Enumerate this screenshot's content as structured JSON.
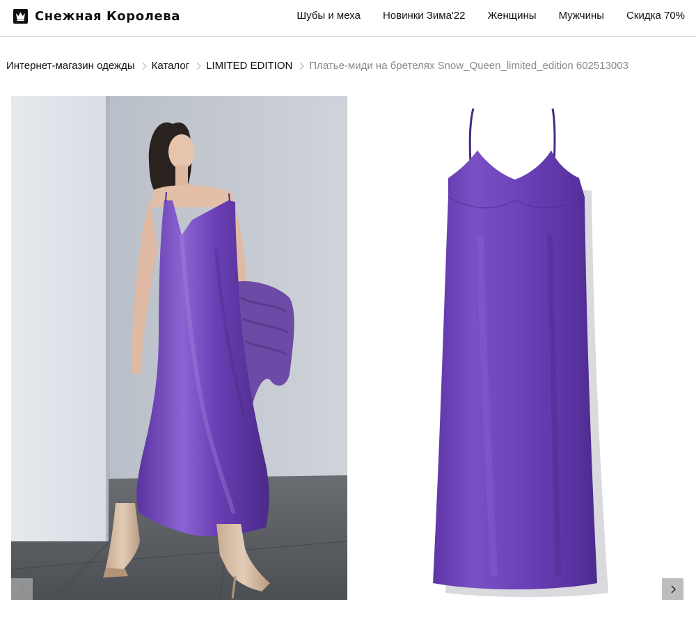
{
  "brand": {
    "name": "Снежная Королева",
    "logo_icon": "crown-icon"
  },
  "nav": {
    "items": [
      {
        "label": "Шубы и меха"
      },
      {
        "label": "Новинки Зима'22"
      },
      {
        "label": "Женщины"
      },
      {
        "label": "Мужчины"
      },
      {
        "label": "Скидка 70%"
      }
    ]
  },
  "breadcrumb": {
    "items": [
      {
        "label": "Интернет-магазин одежды"
      },
      {
        "label": "Каталог"
      },
      {
        "label": "LIMITED EDITION"
      }
    ],
    "current": "Платье-миди на бретелях Snow_Queen_limited_edition 602513003"
  },
  "gallery": {
    "prev_icon": "chevron-left-icon",
    "next_icon": "chevron-right-icon"
  },
  "colors": {
    "dress": "#6a3fb5",
    "dress_shadow": "#4e2b8e",
    "dress_highlight": "#8b63cf",
    "wall": "#c9ced6",
    "floor": "#5a5d61"
  }
}
